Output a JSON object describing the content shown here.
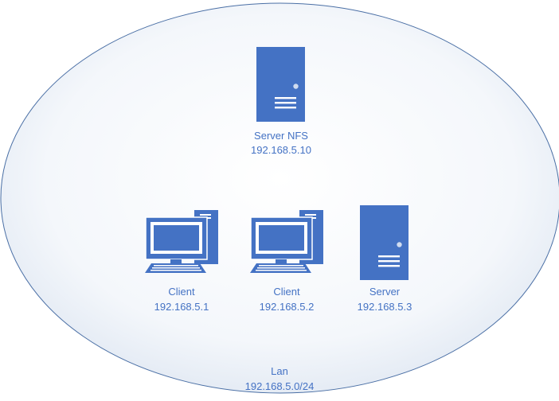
{
  "colors": {
    "device_fill": "#4472c4",
    "label_text": "#4472c4",
    "ellipse_stroke": "#4a6fa5",
    "ellipse_fill_center": "#ffffff",
    "ellipse_fill_edge": "#dfe7f2"
  },
  "network": {
    "name": "Lan",
    "subnet": "192.168.5.0/24"
  },
  "nodes": {
    "nfs_server": {
      "icon": "server-tower-icon",
      "name": "Server NFS",
      "ip": "192.168.5.10"
    },
    "client_1": {
      "icon": "desktop-computer-icon",
      "name": "Client",
      "ip": "192.168.5.1"
    },
    "client_2": {
      "icon": "desktop-computer-icon",
      "name": "Client",
      "ip": "192.168.5.2"
    },
    "server": {
      "icon": "server-tower-icon",
      "name": "Server",
      "ip": "192.168.5.3"
    }
  }
}
